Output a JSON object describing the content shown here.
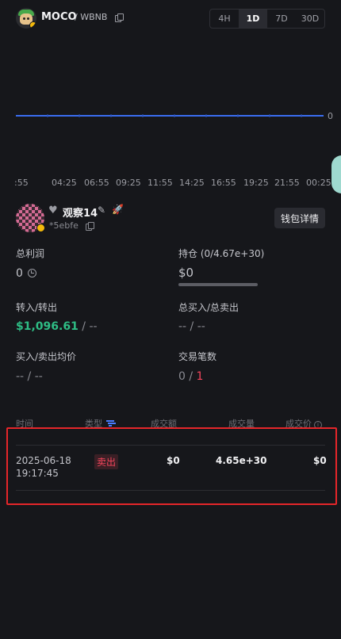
{
  "header": {
    "token": "MOCO",
    "pair": "/ WBNB",
    "timeframes": [
      {
        "label": "4H",
        "active": false
      },
      {
        "label": "1D",
        "active": true
      },
      {
        "label": "7D",
        "active": false
      },
      {
        "label": "30D",
        "active": false
      }
    ]
  },
  "chart_data": {
    "type": "line",
    "x": [
      ":55",
      "04:25",
      "06:55",
      "09:25",
      "11:55",
      "14:25",
      "16:55",
      "19:25",
      "21:55",
      "00:25"
    ],
    "series": [
      {
        "values": [
          0,
          0,
          0,
          0,
          0,
          0,
          0,
          0,
          0,
          0
        ]
      }
    ],
    "ylabel_value": "0",
    "line_color": "#3a6df0"
  },
  "profile": {
    "name": "观察14",
    "id": "*5ebfe",
    "wallet_button": "钱包详情"
  },
  "stats": {
    "total_profit_label": "总利润",
    "total_profit_value": "0",
    "holding_label": "持仓 (0/4.67e+30)",
    "holding_value": "$0",
    "holding_fraction": 0,
    "transfer_label": "转入/转出",
    "transfer_in": "$1,096.61",
    "transfer_sep": "/",
    "transfer_out": "--",
    "total_buy_sell_label": "总买入/总卖出",
    "total_buy_sell_value": "-- / --",
    "avg_label": "买入/卖出均价",
    "avg_value": "-- / --",
    "trades_label": "交易笔数",
    "trades_buy": "0",
    "trades_sep": "/",
    "trades_sell": "1"
  },
  "table": {
    "headers": {
      "time": "时间",
      "type": "类型",
      "amount": "成交额",
      "volume": "成交量",
      "price": "成交价"
    },
    "rows": [
      {
        "date": "2025-06-18",
        "time": "19:17:45",
        "type": "卖出",
        "amount": "$0",
        "volume": "4.65e+30",
        "price": "$0"
      }
    ]
  },
  "colors": {
    "background": "#16171b",
    "green": "#2ebd85",
    "red": "#f6465d",
    "highlight": "#e5262a"
  }
}
